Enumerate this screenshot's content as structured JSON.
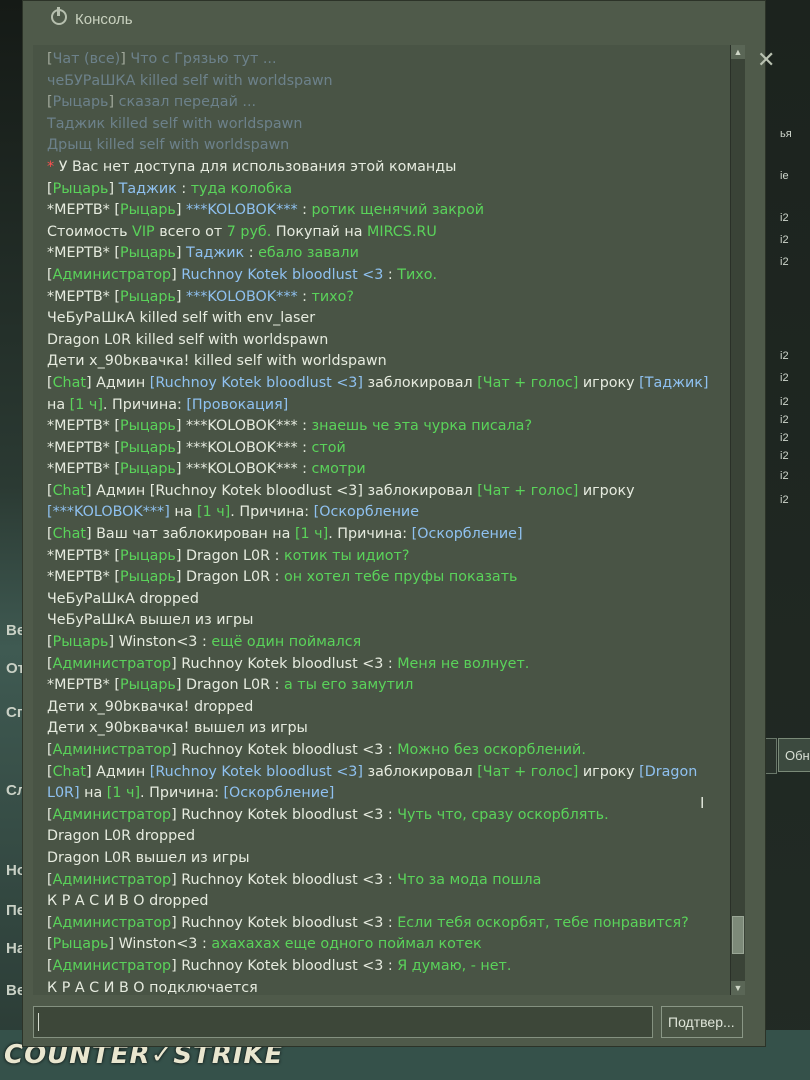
{
  "window": {
    "title": "Консоль",
    "close_glyph": "✕",
    "submit_label": "Подтвер...",
    "input_value": ""
  },
  "background": {
    "logo_text": "COUNTER✓STRIKE",
    "side_labels": [
      "Ве",
      "От",
      "Сп",
      "Сл",
      "Но",
      "Пе",
      "На",
      "Ве"
    ],
    "side_button": "Обн",
    "right_column": [
      "ья",
      "ie",
      "i2",
      "i2",
      "i2",
      "i2",
      "i2",
      "i2",
      "i2",
      "i2",
      "i2",
      "i2",
      "i2"
    ]
  },
  "console_lines": [
    [
      {
        "t": "[",
        "c": "white"
      },
      {
        "t": "Чат (все)",
        "c": "dim"
      },
      {
        "t": "] ",
        "c": "white"
      },
      {
        "t": "Что с Грязью тут",
        "c": "dim"
      },
      {
        "t": " ...",
        "c": "dim"
      }
    ],
    [
      {
        "t": "чеБУРаШКА",
        "c": "dim"
      },
      {
        "t": " killed self with worldspawn",
        "c": "dim"
      }
    ],
    [
      {
        "t": "[",
        "c": "white"
      },
      {
        "t": "Рыцарь",
        "c": "dim"
      },
      {
        "t": "] ",
        "c": "white"
      },
      {
        "t": "сказал передай ...",
        "c": "dim"
      }
    ],
    [
      {
        "t": "Таджик killed self with worldspawn",
        "c": "dim"
      }
    ],
    [
      {
        "t": "Дрыщ killed self with worldspawn",
        "c": "dim"
      }
    ],
    [
      {
        "t": "* ",
        "c": "red"
      },
      {
        "t": "У Вас нет доступа для использования этой команды",
        "c": "white"
      }
    ],
    [
      {
        "t": "[",
        "c": "white"
      },
      {
        "t": "Рыцарь",
        "c": "green"
      },
      {
        "t": "] ",
        "c": "white"
      },
      {
        "t": "Таджик",
        "c": "blue"
      },
      {
        "t": " : ",
        "c": "white"
      },
      {
        "t": "туда колобка",
        "c": "green"
      }
    ],
    [
      {
        "t": "*МЕРТВ* [",
        "c": "white"
      },
      {
        "t": "Рыцарь",
        "c": "green"
      },
      {
        "t": "] ",
        "c": "white"
      },
      {
        "t": "***KOLOBOK***",
        "c": "blue"
      },
      {
        "t": " : ",
        "c": "white"
      },
      {
        "t": "ротик щенячий закрой",
        "c": "green"
      }
    ],
    [
      {
        "t": "Стоимость ",
        "c": "white"
      },
      {
        "t": "VIP",
        "c": "green"
      },
      {
        "t": " всего от ",
        "c": "white"
      },
      {
        "t": "7 руб.",
        "c": "green"
      },
      {
        "t": " Покупай на ",
        "c": "white"
      },
      {
        "t": "MIRCS.RU",
        "c": "green"
      }
    ],
    [
      {
        "t": "*МЕРТВ* [",
        "c": "white"
      },
      {
        "t": "Рыцарь",
        "c": "green"
      },
      {
        "t": "] ",
        "c": "white"
      },
      {
        "t": "Таджик",
        "c": "blue"
      },
      {
        "t": " : ",
        "c": "white"
      },
      {
        "t": "ебало завали",
        "c": "green"
      }
    ],
    [
      {
        "t": "[",
        "c": "white"
      },
      {
        "t": "Администратор",
        "c": "green"
      },
      {
        "t": "] ",
        "c": "white"
      },
      {
        "t": "Ruchnoy Kotek bloodlust <3",
        "c": "blue"
      },
      {
        "t": " : ",
        "c": "white"
      },
      {
        "t": "Тихо.",
        "c": "green"
      }
    ],
    [
      {
        "t": "*МЕРТВ* [",
        "c": "white"
      },
      {
        "t": "Рыцарь",
        "c": "green"
      },
      {
        "t": "] ",
        "c": "white"
      },
      {
        "t": "***KOLOBOK***",
        "c": "blue"
      },
      {
        "t": " : ",
        "c": "white"
      },
      {
        "t": "тихо?",
        "c": "green"
      }
    ],
    [
      {
        "t": "ЧеБуРаШкА killed self with env_laser",
        "c": "white"
      }
    ],
    [
      {
        "t": "Dragon L0R killed self with worldspawn",
        "c": "white"
      }
    ],
    [
      {
        "t": "Дети x_90bквачка! killed self with worldspawn",
        "c": "white"
      }
    ],
    [
      {
        "t": "[",
        "c": "white"
      },
      {
        "t": "Chat",
        "c": "green"
      },
      {
        "t": "] Админ ",
        "c": "white"
      },
      {
        "t": "[Ruchnoy Kotek bloodlust <3]",
        "c": "blue"
      },
      {
        "t": " заблокировал ",
        "c": "white"
      },
      {
        "t": "[Чат + голос]",
        "c": "green"
      },
      {
        "t": " игроку ",
        "c": "white"
      },
      {
        "t": "[Таджик]",
        "c": "blue"
      }
    ],
    [
      {
        "t": "на ",
        "c": "white"
      },
      {
        "t": "[1 ч]",
        "c": "green"
      },
      {
        "t": ". Причина: ",
        "c": "white"
      },
      {
        "t": "[Провокация]",
        "c": "blue"
      }
    ],
    [
      {
        "t": "*МЕРТВ* [",
        "c": "white"
      },
      {
        "t": "Рыцарь",
        "c": "green"
      },
      {
        "t": "] ",
        "c": "white"
      },
      {
        "t": "***KOLOBOK***",
        "c": "white"
      },
      {
        "t": " : ",
        "c": "white"
      },
      {
        "t": "знаешь че эта чурка писала?",
        "c": "green"
      }
    ],
    [
      {
        "t": "*МЕРТВ* [",
        "c": "white"
      },
      {
        "t": "Рыцарь",
        "c": "green"
      },
      {
        "t": "] ",
        "c": "white"
      },
      {
        "t": "***KOLOBOK***",
        "c": "white"
      },
      {
        "t": " : ",
        "c": "white"
      },
      {
        "t": "стой",
        "c": "green"
      }
    ],
    [
      {
        "t": "*МЕРТВ* [",
        "c": "white"
      },
      {
        "t": "Рыцарь",
        "c": "green"
      },
      {
        "t": "] ",
        "c": "white"
      },
      {
        "t": "***KOLOBOK***",
        "c": "white"
      },
      {
        "t": " : ",
        "c": "white"
      },
      {
        "t": "смотри",
        "c": "green"
      }
    ],
    [
      {
        "t": "[",
        "c": "white"
      },
      {
        "t": "Chat",
        "c": "green"
      },
      {
        "t": "] Админ [Ruchnoy Kotek bloodlust <3] заблокировал ",
        "c": "white"
      },
      {
        "t": "[Чат + голос]",
        "c": "green"
      },
      {
        "t": " игроку",
        "c": "white"
      }
    ],
    [
      {
        "t": "[***KOLOBOK***]",
        "c": "blue"
      },
      {
        "t": " на ",
        "c": "white"
      },
      {
        "t": "[1 ч]",
        "c": "green"
      },
      {
        "t": ". Причина: ",
        "c": "white"
      },
      {
        "t": "[Оскорбление",
        "c": "blue"
      }
    ],
    [
      {
        "t": "[",
        "c": "white"
      },
      {
        "t": "Chat",
        "c": "green"
      },
      {
        "t": "] Ваш чат заблокирован на ",
        "c": "white"
      },
      {
        "t": "[1 ч]",
        "c": "green"
      },
      {
        "t": ". Причина: ",
        "c": "white"
      },
      {
        "t": "[Оскорбление]",
        "c": "blue"
      }
    ],
    [
      {
        "t": "*МЕРТВ* [",
        "c": "white"
      },
      {
        "t": "Рыцарь",
        "c": "green"
      },
      {
        "t": "] Dragon L0R : ",
        "c": "white"
      },
      {
        "t": "котик ты идиот?",
        "c": "green"
      }
    ],
    [
      {
        "t": "*МЕРТВ* [",
        "c": "white"
      },
      {
        "t": "Рыцарь",
        "c": "green"
      },
      {
        "t": "] Dragon L0R : ",
        "c": "white"
      },
      {
        "t": "он хотел тебе пруфы показать",
        "c": "green"
      }
    ],
    [
      {
        "t": "ЧеБуРаШкА dropped",
        "c": "white"
      }
    ],
    [
      {
        "t": "ЧеБуРаШкА вышел из игры",
        "c": "white"
      }
    ],
    [
      {
        "t": "[",
        "c": "white"
      },
      {
        "t": "Рыцарь",
        "c": "green"
      },
      {
        "t": "] Winston<3 : ",
        "c": "white"
      },
      {
        "t": "ещё один поймался",
        "c": "green"
      }
    ],
    [
      {
        "t": "[",
        "c": "white"
      },
      {
        "t": "Администратор",
        "c": "green"
      },
      {
        "t": "] Ruchnoy Kotek bloodlust <3 : ",
        "c": "white"
      },
      {
        "t": "Меня не волнует.",
        "c": "green"
      }
    ],
    [
      {
        "t": "*МЕРТВ* [",
        "c": "white"
      },
      {
        "t": "Рыцарь",
        "c": "green"
      },
      {
        "t": "] Dragon L0R : ",
        "c": "white"
      },
      {
        "t": "а ты его замутил",
        "c": "green"
      }
    ],
    [
      {
        "t": "Дети x_90bквачка! dropped",
        "c": "white"
      }
    ],
    [
      {
        "t": "Дети x_90bквачка! вышел из игры",
        "c": "white"
      }
    ],
    [
      {
        "t": "[",
        "c": "white"
      },
      {
        "t": "Администратор",
        "c": "green"
      },
      {
        "t": "] Ruchnoy Kotek bloodlust <3 : ",
        "c": "white"
      },
      {
        "t": "Можно без оскорблений.",
        "c": "green"
      }
    ],
    [
      {
        "t": "[",
        "c": "white"
      },
      {
        "t": "Chat",
        "c": "green"
      },
      {
        "t": "] Админ ",
        "c": "white"
      },
      {
        "t": "[Ruchnoy Kotek bloodlust <3]",
        "c": "blue"
      },
      {
        "t": " заблокировал ",
        "c": "white"
      },
      {
        "t": "[Чат + голос]",
        "c": "green"
      },
      {
        "t": " игроку ",
        "c": "white"
      },
      {
        "t": "[Dragon",
        "c": "blue"
      }
    ],
    [
      {
        "t": "L0R]",
        "c": "blue"
      },
      {
        "t": " на ",
        "c": "white"
      },
      {
        "t": "[1 ч]",
        "c": "green"
      },
      {
        "t": ". Причина: ",
        "c": "white"
      },
      {
        "t": "[Оскорбление]",
        "c": "blue"
      }
    ],
    [
      {
        "t": "[",
        "c": "white"
      },
      {
        "t": "Администратор",
        "c": "green"
      },
      {
        "t": "] Ruchnoy Kotek bloodlust <3 : ",
        "c": "white"
      },
      {
        "t": "Чуть что, сразу оскорблять.",
        "c": "green"
      }
    ],
    [
      {
        "t": "Dragon L0R dropped",
        "c": "white"
      }
    ],
    [
      {
        "t": "Dragon L0R вышел из игры",
        "c": "white"
      }
    ],
    [
      {
        "t": "[",
        "c": "white"
      },
      {
        "t": "Администратор",
        "c": "green"
      },
      {
        "t": "] Ruchnoy Kotek bloodlust <3 : ",
        "c": "white"
      },
      {
        "t": "Что за мода пошла",
        "c": "green"
      }
    ],
    [
      {
        "t": "К Р А С И В О dropped",
        "c": "white"
      }
    ],
    [
      {
        "t": "[",
        "c": "white"
      },
      {
        "t": "Администратор",
        "c": "green"
      },
      {
        "t": "] Ruchnoy Kotek bloodlust <3 : ",
        "c": "white"
      },
      {
        "t": "Если тебя оскорбят, тебе понравится?",
        "c": "green"
      }
    ],
    [
      {
        "t": "[",
        "c": "white"
      },
      {
        "t": "Рыцарь",
        "c": "green"
      },
      {
        "t": "] Winston<3 : ",
        "c": "white"
      },
      {
        "t": "ахахахах еще одного поймал котек",
        "c": "green"
      }
    ],
    [
      {
        "t": "[",
        "c": "white"
      },
      {
        "t": "Администратор",
        "c": "green"
      },
      {
        "t": "] Ruchnoy Kotek bloodlust <3 : ",
        "c": "white"
      },
      {
        "t": "Я думаю, - нет.",
        "c": "green"
      }
    ],
    [
      {
        "t": "К Р А С И В О подключается",
        "c": "white"
      }
    ]
  ],
  "colors": {
    "white": "#e6ebdf",
    "green": "#5ad35a",
    "blue": "#8fc1f0",
    "red": "#ff5050",
    "dim": "#8aa6c4"
  },
  "scrollbar": {
    "position_fraction": 0.97
  }
}
